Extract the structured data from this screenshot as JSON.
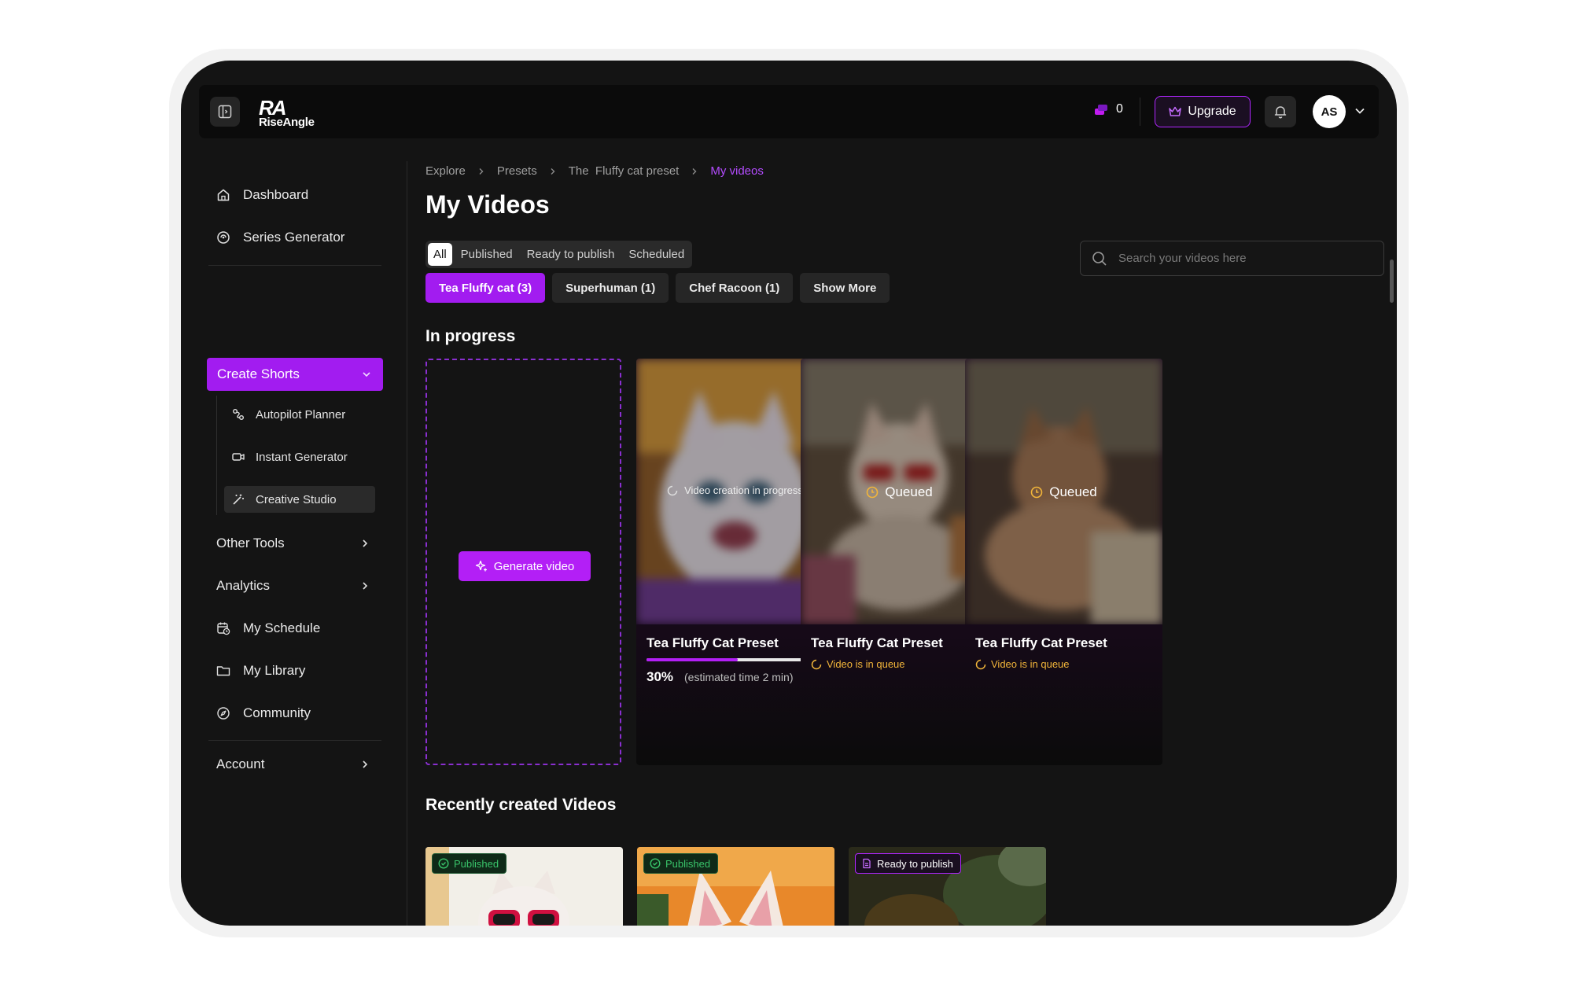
{
  "header": {
    "logo_mark": "RA",
    "logo_text": "RiseAngle",
    "credits": "0",
    "upgrade_label": "Upgrade",
    "avatar_initials": "AS"
  },
  "sidebar": {
    "dashboard": "Dashboard",
    "series_generator": "Series Generator",
    "create_shorts": "Create Shorts",
    "autopilot_planner": "Autopilot Planner",
    "instant_generator": "Instant Generator",
    "creative_studio": "Creative Studio",
    "other_tools": "Other Tools",
    "analytics": "Analytics",
    "my_schedule": "My Schedule",
    "my_library": "My Library",
    "community": "Community",
    "account": "Account"
  },
  "breadcrumb": [
    "Explore",
    "Presets",
    "The  Fluffy cat preset",
    "My videos"
  ],
  "page_title": "My Videos",
  "filter_tabs": [
    "All",
    "Published",
    "Ready to publish",
    "Scheduled"
  ],
  "search": {
    "placeholder": "Search your videos here"
  },
  "chips": [
    "Tea Fluffy cat (3)",
    "Superhuman (1)",
    "Chef Racoon (1)",
    "Show More"
  ],
  "in_progress": {
    "title": "In progress",
    "generate_label": "Generate video",
    "cards": [
      {
        "status": "Video creation in progress",
        "title": "Tea Fluffy Cat Preset",
        "percent": "30%",
        "progress": 0.5,
        "eta": "(estimated time 2 min)"
      },
      {
        "status": "Queued",
        "title": "Tea Fluffy Cat Preset",
        "sub_status": "Video is in queue"
      },
      {
        "status": "Queued",
        "title": "Tea Fluffy Cat Preset",
        "sub_status": "Video is in queue"
      }
    ]
  },
  "recent": {
    "title": "Recently created Videos",
    "cards": [
      {
        "badge": "Published"
      },
      {
        "badge": "Published"
      },
      {
        "badge": "Ready to publish"
      }
    ]
  },
  "colors": {
    "accent": "#a21cf0",
    "queue": "#f2b53a",
    "published": "#39c46a"
  }
}
